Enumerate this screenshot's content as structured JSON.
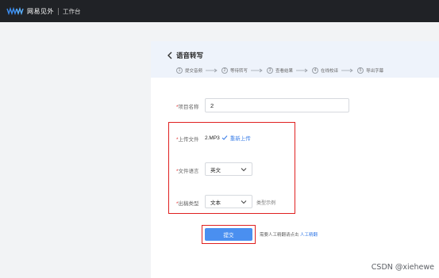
{
  "topbar": {
    "brand": "网易见外",
    "workspace": "工作台"
  },
  "header": {
    "title": "语音转写",
    "steps": [
      {
        "num": "1",
        "label": "提交音频"
      },
      {
        "num": "2",
        "label": "等待转写"
      },
      {
        "num": "3",
        "label": "查看结果"
      },
      {
        "num": "4",
        "label": "在线校译"
      },
      {
        "num": "5",
        "label": "导出字幕"
      }
    ]
  },
  "form": {
    "project_name_label": "项目名称",
    "project_name_value": "2",
    "upload_label": "上传文件",
    "file_name": "2.MP3",
    "reupload_label": "重新上传",
    "language_label": "文件语言",
    "language_value": "英文",
    "output_label": "出稿类型",
    "output_value": "文本",
    "output_hint": "类型示例",
    "submit_label": "提交",
    "manual_note": "需要人工精翻请点击",
    "manual_link": "人工精翻",
    "required_mark": "*"
  },
  "watermark": "CSDN @xiehewe",
  "colors": {
    "topbar": "#202226",
    "accent": "#4a8ff0",
    "link": "#3c7fe8",
    "highlight": "#e02020",
    "header_bg": "#eef3fb"
  }
}
